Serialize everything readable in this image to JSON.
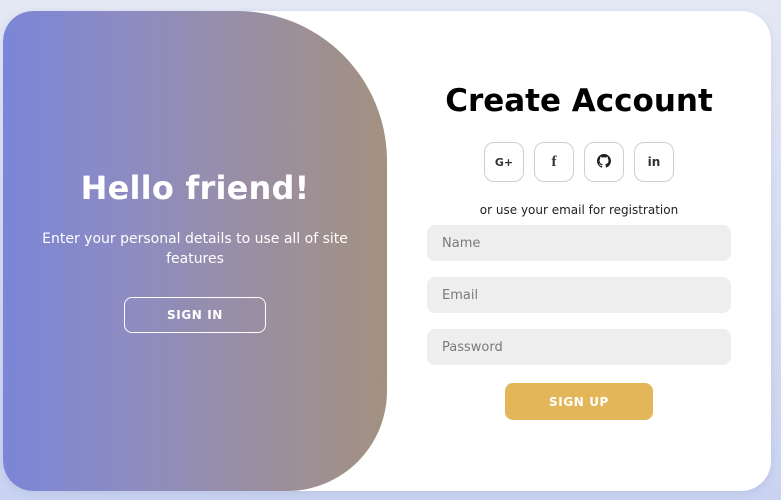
{
  "welcome": {
    "title": "Hello friend!",
    "subtitle": "Enter your personal details to use all of site features",
    "signin_label": "SIGN IN"
  },
  "signup": {
    "title": "Create Account",
    "social": [
      {
        "name": "google-icon",
        "glyph": "G+"
      },
      {
        "name": "facebook-icon",
        "glyph": "f"
      },
      {
        "name": "github-icon",
        "glyph": "github"
      },
      {
        "name": "linkedin-icon",
        "glyph": "in"
      }
    ],
    "divider_text": "or use your email for registration",
    "fields": {
      "name_placeholder": "Name",
      "email_placeholder": "Email",
      "password_placeholder": "Password"
    },
    "submit_label": "SIGN UP"
  },
  "colors": {
    "gradient_start": "#7b86d8",
    "gradient_end": "#a39180",
    "accent": "#e3b65a"
  }
}
